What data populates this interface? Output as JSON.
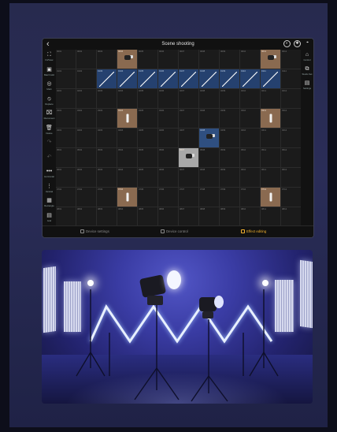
{
  "app": {
    "title": "Scene shooting",
    "back_glyph": "‹",
    "header_icons": [
      "preset-icon",
      "settings-icon",
      "location-pin-icon"
    ],
    "left_sidebar": [
      {
        "icon": "fit-view-icon",
        "glyph": "⛶",
        "label": "Fit/View"
      },
      {
        "icon": "batch-add-icon",
        "glyph": "▣",
        "label": "Batch Add"
      },
      {
        "icon": "mark-icon",
        "glyph": "◎",
        "label": "Mark"
      },
      {
        "icon": "replace-icon",
        "glyph": "⦸",
        "label": "Replace"
      },
      {
        "icon": "disconnect-icon",
        "glyph": "⌧",
        "label": "Disconnect"
      },
      {
        "icon": "delete-icon",
        "glyph": "🗑",
        "label": "Delete"
      },
      {
        "icon": "redo-icon",
        "glyph": "↷",
        "label": ""
      },
      {
        "icon": "undo-icon",
        "glyph": "↶",
        "label": ""
      },
      {
        "icon": "horizontal-icon",
        "glyph": "•••",
        "label": "Horizontal"
      },
      {
        "icon": "vertical-icon",
        "glyph": "⋮",
        "label": "Vertical"
      },
      {
        "icon": "rectangle-icon",
        "glyph": "▦",
        "label": "Rectangle"
      },
      {
        "icon": "grid-icon",
        "glyph": "▤",
        "label": "Grid"
      }
    ],
    "right_sidebar": [
      {
        "icon": "control-icon",
        "glyph": "⌂",
        "label": "Control"
      },
      {
        "icon": "studio-icon",
        "glyph": "⧉",
        "label": "Studio Set"
      },
      {
        "icon": "settings-panel-icon",
        "glyph": "▤",
        "label": "Settings"
      }
    ],
    "grid": {
      "rows": [
        [
          "0001",
          "0002",
          "0003",
          "0004",
          "0005",
          "0006",
          "0007",
          "0008",
          "0009",
          "0010",
          "0011",
          "0012"
        ],
        [
          "0101",
          "0102",
          "0103",
          "0104",
          "0105",
          "0106",
          "0107",
          "0108",
          "0109",
          "0110",
          "0111",
          "0112"
        ],
        [
          "0201",
          "0202",
          "0203",
          "0204",
          "0205",
          "0206",
          "0207",
          "0208",
          "0209",
          "0210",
          "0211",
          "0212"
        ],
        [
          "0301",
          "0302",
          "0303",
          "0304",
          "0305",
          "0306",
          "0307",
          "0308",
          "0309",
          "0310",
          "0311",
          "0312"
        ],
        [
          "0401",
          "0402",
          "0403",
          "0404",
          "0405",
          "0406",
          "0407",
          "0408",
          "0409",
          "0410",
          "0411",
          "0412"
        ],
        [
          "0501",
          "0502",
          "0503",
          "0504",
          "0505",
          "0506",
          "0507",
          "0508",
          "0509",
          "0510",
          "0511",
          "0512"
        ],
        [
          "0601",
          "0602",
          "0603",
          "0604",
          "0605",
          "0606",
          "0607",
          "0608",
          "0609",
          "0610",
          "0611",
          "0612"
        ],
        [
          "0701",
          "0702",
          "0703",
          "0704",
          "0705",
          "0706",
          "0707",
          "0708",
          "0709",
          "0710",
          "0711",
          "0712"
        ],
        [
          "0801",
          "0802",
          "0803",
          "0804",
          "0805",
          "0806",
          "0807",
          "0808",
          "0809",
          "0810",
          "0811",
          "0812"
        ]
      ],
      "fixtures": [
        {
          "r": 0,
          "c": 3,
          "type": "cob",
          "tone": "warm"
        },
        {
          "r": 0,
          "c": 10,
          "type": "cob",
          "tone": "warm"
        },
        {
          "r": 3,
          "c": 3,
          "type": "tube",
          "tone": "warm"
        },
        {
          "r": 3,
          "c": 10,
          "type": "tube",
          "tone": "warm"
        },
        {
          "r": 4,
          "c": 7,
          "type": "cob",
          "tone": "selected"
        },
        {
          "r": 5,
          "c": 6,
          "type": "cob",
          "tone": "cool"
        },
        {
          "r": 7,
          "c": 3,
          "type": "tube",
          "tone": "warm"
        },
        {
          "r": 7,
          "c": 10,
          "type": "tube",
          "tone": "warm"
        }
      ],
      "tube_chain": {
        "r": 1,
        "c_from": 2,
        "c_to": 10
      }
    },
    "bottom_tabs": [
      {
        "label": "Device settings",
        "icon": "device-settings-icon",
        "active": false
      },
      {
        "label": "Device control",
        "icon": "device-control-icon",
        "active": false
      },
      {
        "label": "Effect editing",
        "icon": "effect-editing-icon",
        "active": true
      }
    ],
    "colors": {
      "accent": "#f3b12e",
      "selection": "#25416f",
      "fixture_warm": "#8a6a50"
    }
  },
  "photo": {
    "description_icon": "studio-photo"
  }
}
